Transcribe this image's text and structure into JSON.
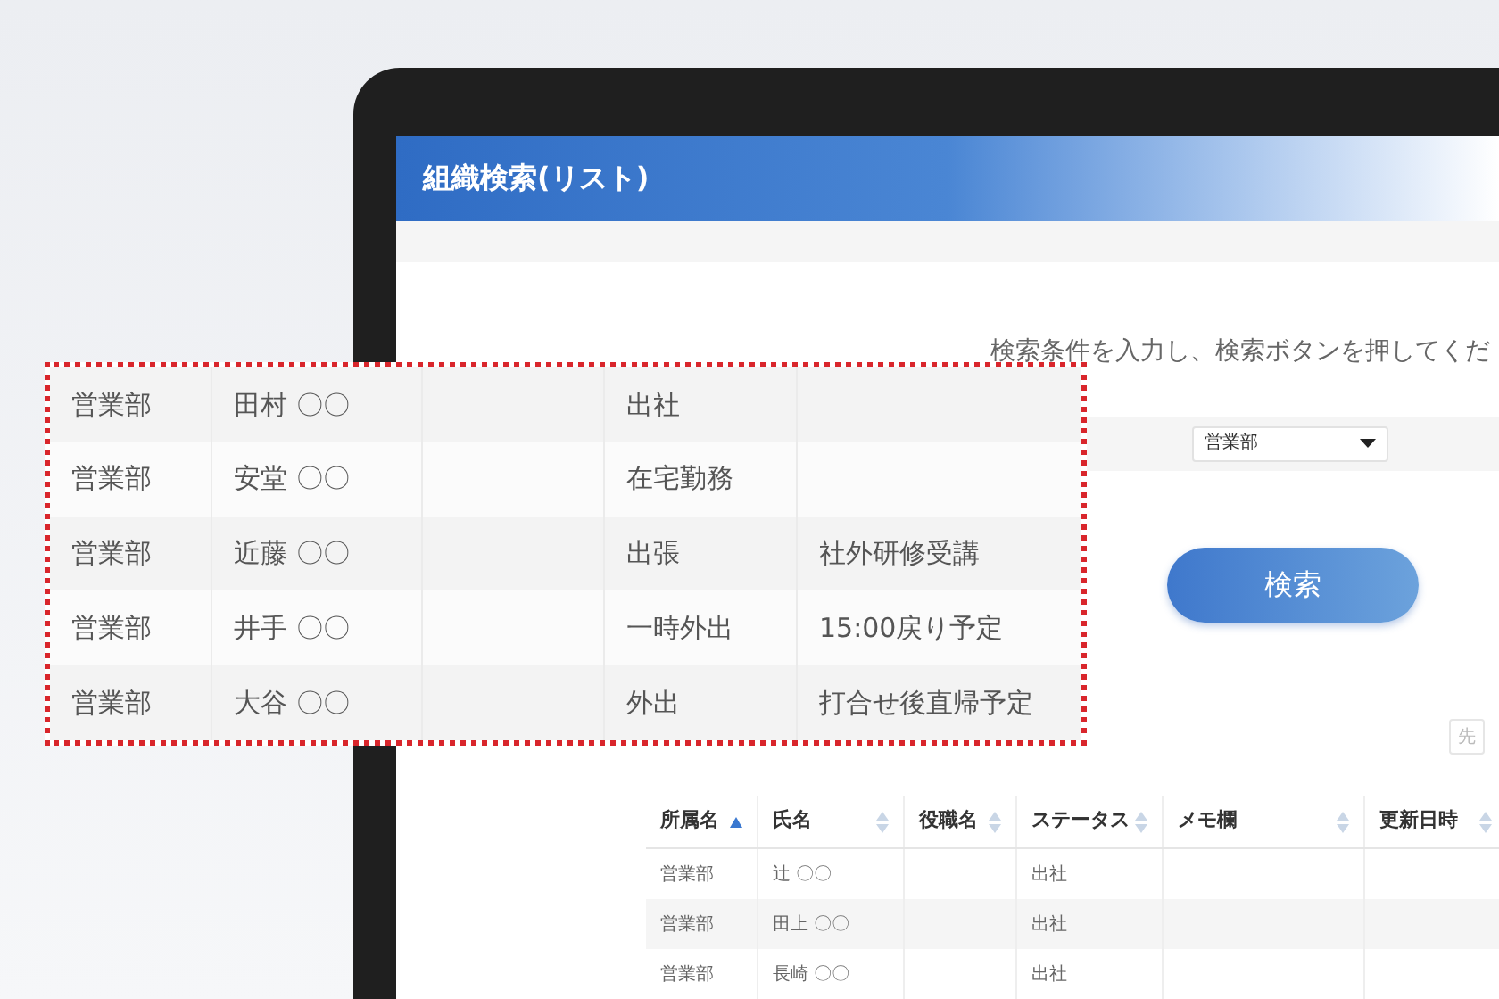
{
  "window": {
    "title": "組織検索(リスト)"
  },
  "instruction": "検索条件を入力し、検索ボタンを押してくだ",
  "filter": {
    "value": "営業部"
  },
  "search_button": "検索",
  "pager": {
    "label": "先"
  },
  "table": {
    "columns": [
      {
        "label": "所属名",
        "sorted": true
      },
      {
        "label": "氏名",
        "sorted": false
      },
      {
        "label": "役職名",
        "sorted": false
      },
      {
        "label": "ステータス",
        "sorted": false
      },
      {
        "label": "メモ欄",
        "sorted": false
      },
      {
        "label": "更新日時",
        "sorted": false
      }
    ],
    "rows": [
      [
        "営業部",
        "辻 〇〇",
        "",
        "出社",
        "",
        ""
      ],
      [
        "営業部",
        "田上 〇〇",
        "",
        "出社",
        "",
        ""
      ],
      [
        "営業部",
        "長崎 〇〇",
        "",
        "出社",
        "",
        ""
      ]
    ]
  },
  "callout": {
    "rows": [
      [
        "営業部",
        "田村 〇〇",
        "",
        "出社",
        ""
      ],
      [
        "営業部",
        "安堂 〇〇",
        "",
        "在宅勤務",
        ""
      ],
      [
        "営業部",
        "近藤 〇〇",
        "",
        "出張",
        "社外研修受講"
      ],
      [
        "営業部",
        "井手 〇〇",
        "",
        "一時外出",
        "15:00戻り予定"
      ],
      [
        "営業部",
        "大谷 〇〇",
        "",
        "外出",
        "打合せ後直帰予定"
      ]
    ]
  }
}
